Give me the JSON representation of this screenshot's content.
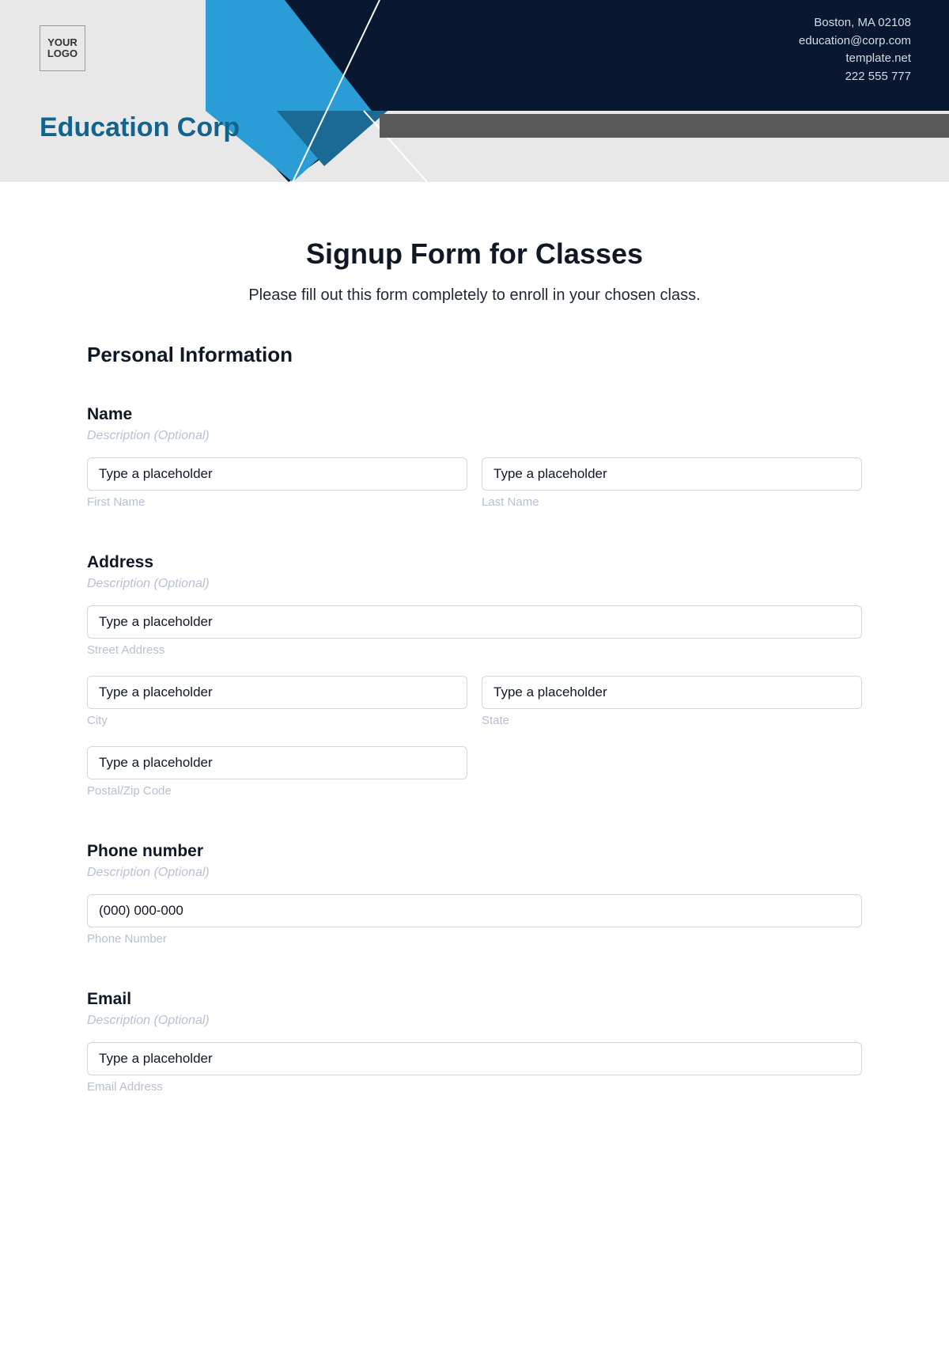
{
  "header": {
    "logo_line1": "YOUR",
    "logo_line2": "LOGO",
    "company": "Education Corp",
    "contact": {
      "address": "Boston, MA 02108",
      "email": "education@corp.com",
      "website": "template.net",
      "phone": "222 555 777"
    }
  },
  "form": {
    "title": "Signup Form for Classes",
    "subtitle": "Please fill out this form completely to enroll in your chosen class.",
    "section1": "Personal Information",
    "name": {
      "label": "Name",
      "desc": "Description (Optional)",
      "first_ph": "Type a placeholder",
      "first_sub": "First Name",
      "last_ph": "Type a placeholder",
      "last_sub": "Last Name"
    },
    "address": {
      "label": "Address",
      "desc": "Description (Optional)",
      "street_ph": "Type a placeholder",
      "street_sub": "Street Address",
      "city_ph": "Type a placeholder",
      "city_sub": "City",
      "state_ph": "Type a placeholder",
      "state_sub": "State",
      "zip_ph": "Type a placeholder",
      "zip_sub": "Postal/Zip Code"
    },
    "phone": {
      "label": "Phone number",
      "desc": "Description (Optional)",
      "ph": "(000) 000-000",
      "sub": "Phone Number"
    },
    "email": {
      "label": "Email",
      "desc": "Description (Optional)",
      "ph": "Type a placeholder",
      "sub": "Email Address"
    }
  }
}
